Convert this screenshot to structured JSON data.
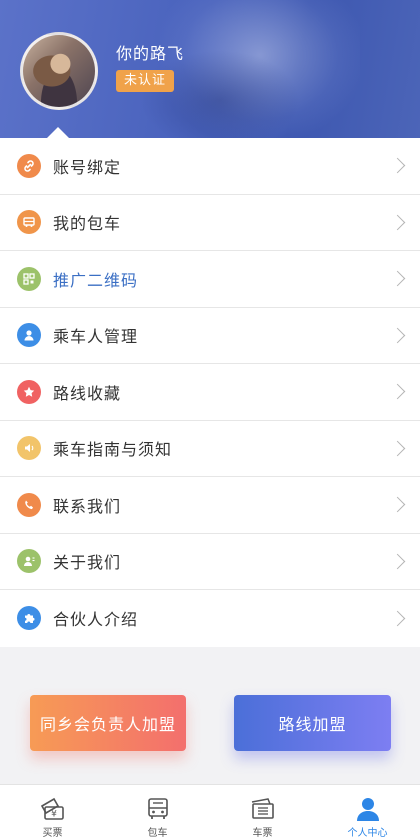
{
  "profile": {
    "username": "你的路飞",
    "status_badge": "未认证"
  },
  "menu": {
    "items": [
      {
        "label": "账号绑定",
        "icon": "link-icon",
        "color": "#f08a4b"
      },
      {
        "label": "我的包车",
        "icon": "bus-icon",
        "color": "#f0954a"
      },
      {
        "label": "推广二维码",
        "icon": "qrcode-icon",
        "color": "#9cc26a"
      },
      {
        "label": "乘车人管理",
        "icon": "person-icon",
        "color": "#3d8ee6"
      },
      {
        "label": "路线收藏",
        "icon": "star-icon",
        "color": "#f06262"
      },
      {
        "label": "乘车指南与须知",
        "icon": "speaker-icon",
        "color": "#f2c46a"
      },
      {
        "label": "联系我们",
        "icon": "phone-icon",
        "color": "#f08a4b"
      },
      {
        "label": "关于我们",
        "icon": "contact-icon",
        "color": "#9cc26a"
      },
      {
        "label": "合伙人介绍",
        "icon": "puzzle-icon",
        "color": "#3d8ee6"
      }
    ]
  },
  "join": {
    "left_label": "同乡会负责人加盟",
    "right_label": "路线加盟"
  },
  "tabbar": {
    "tabs": [
      {
        "label": "买票",
        "icon": "buy-ticket-icon"
      },
      {
        "label": "包车",
        "icon": "charter-bus-icon"
      },
      {
        "label": "车票",
        "icon": "ticket-icon"
      },
      {
        "label": "个人中心",
        "icon": "profile-icon"
      }
    ],
    "active_color": "#2d86e6"
  }
}
